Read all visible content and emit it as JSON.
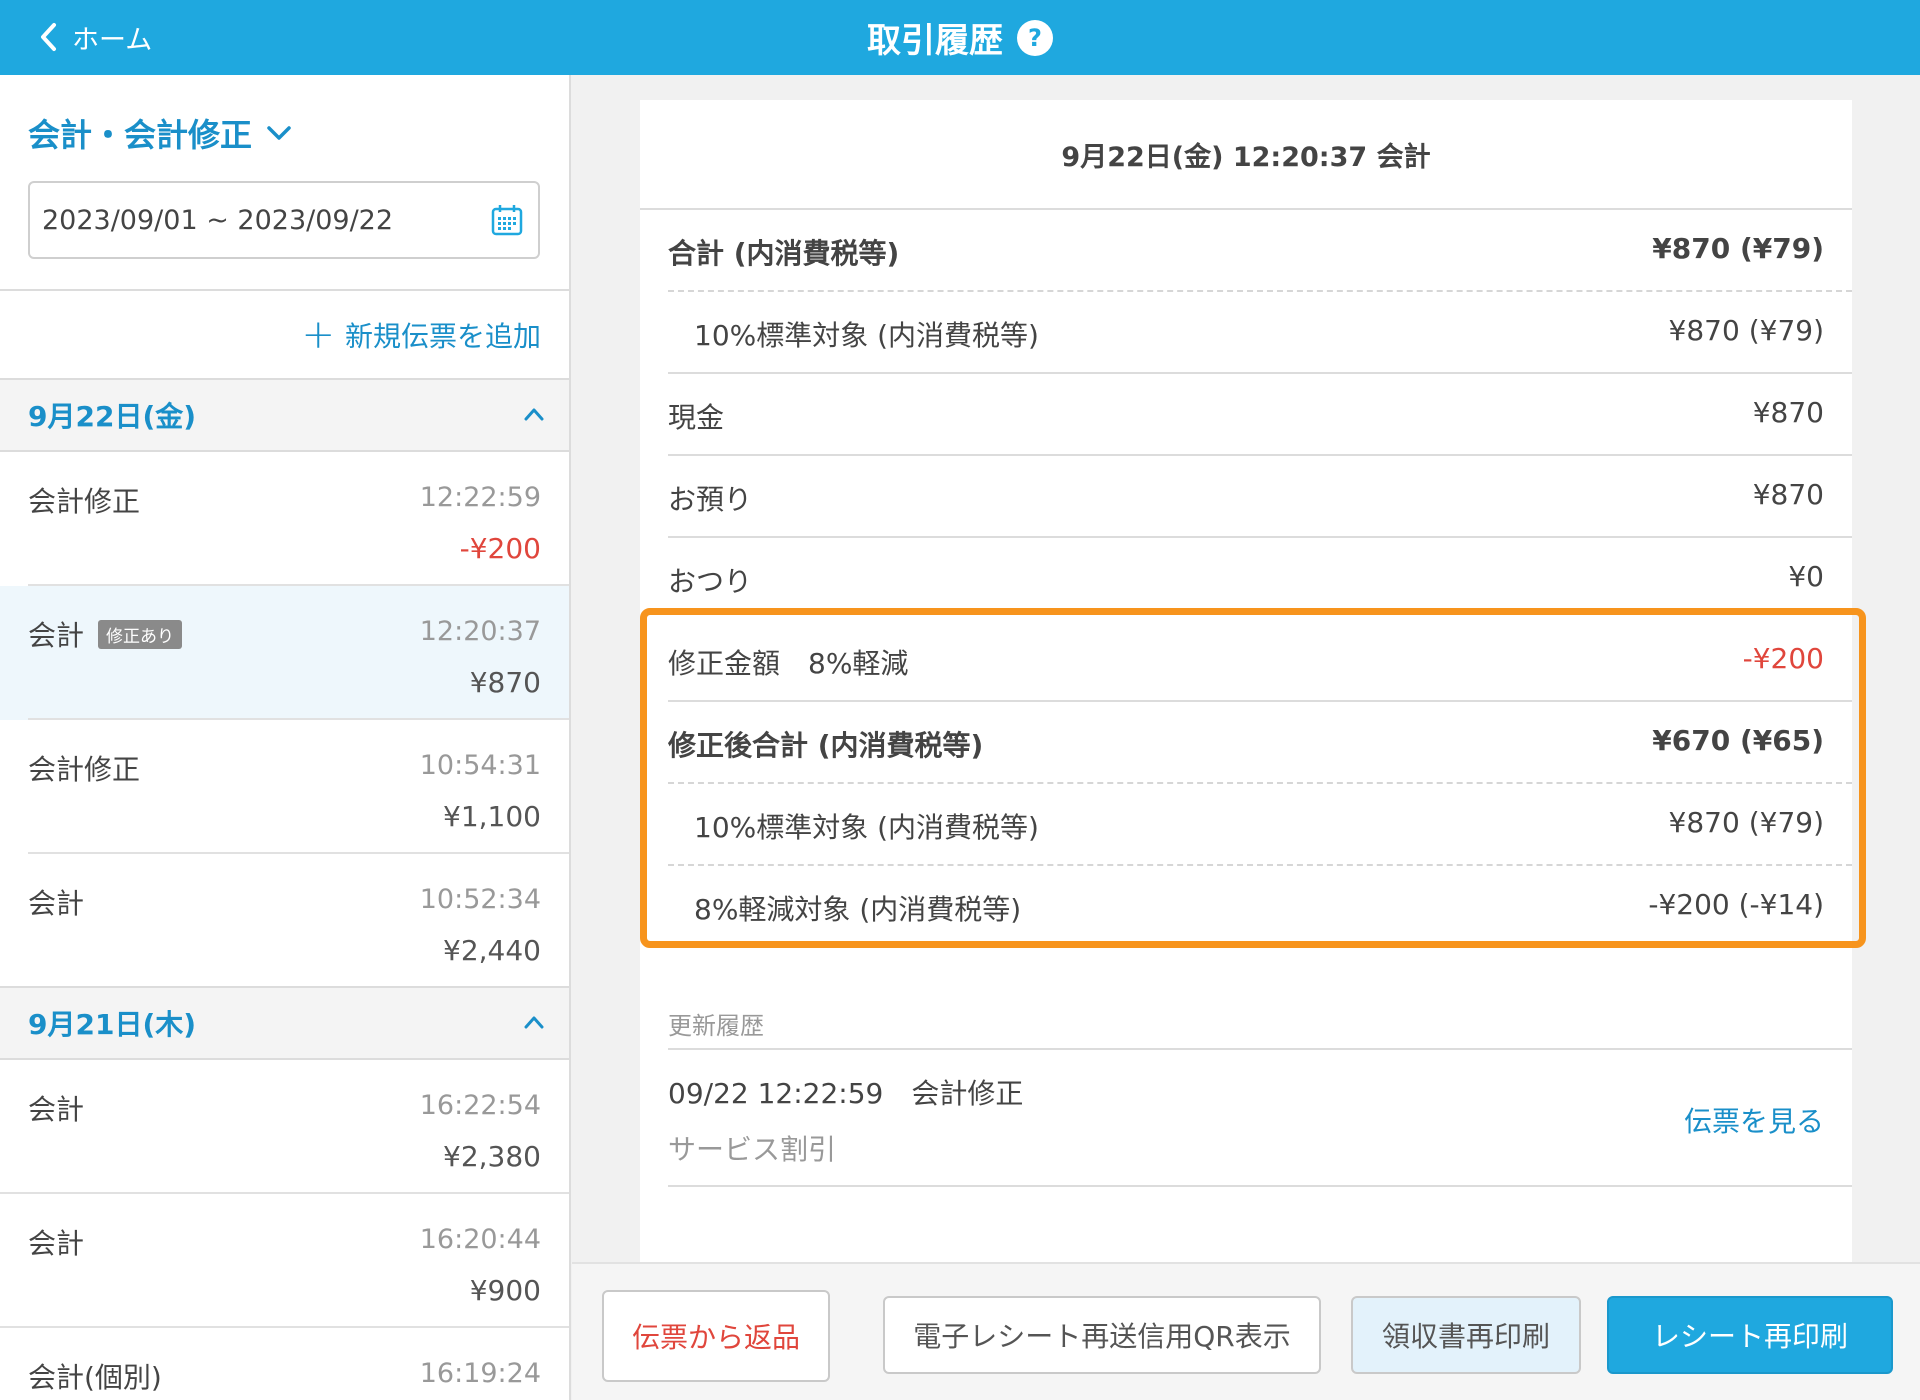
{
  "header": {
    "back_label": "ホーム",
    "title": "取引履歴",
    "help_symbol": "?"
  },
  "sidebar": {
    "filter_label": "会計・会計修正",
    "date_range": "2023/09/01 ~ 2023/09/22",
    "add_slip_label": "新規伝票を追加",
    "add_slip_symbol": "+",
    "groups": [
      {
        "date": "9月22日(金)",
        "items": [
          {
            "name": "会計修正",
            "time": "12:22:59",
            "amount": "-¥200",
            "badge": ""
          },
          {
            "name": "会計",
            "time": "12:20:37",
            "amount": "¥870",
            "badge": "修正あり"
          },
          {
            "name": "会計修正",
            "time": "10:54:31",
            "amount": "¥1,100",
            "badge": ""
          },
          {
            "name": "会計",
            "time": "10:52:34",
            "amount": "¥2,440",
            "badge": ""
          }
        ]
      },
      {
        "date": "9月21日(木)",
        "items": [
          {
            "name": "会計",
            "time": "16:22:54",
            "amount": "¥2,380",
            "badge": ""
          },
          {
            "name": "会計",
            "time": "16:20:44",
            "amount": "¥900",
            "badge": ""
          },
          {
            "name": "会計(個別)",
            "time": "16:19:24",
            "amount": "",
            "badge": ""
          }
        ]
      }
    ]
  },
  "detail": {
    "heading": "9月22日(金) 12:20:37 会計",
    "rows": [
      {
        "label": "合計 (内消費税等)",
        "value": "¥870 (¥79)"
      },
      {
        "label": "10%標準対象 (内消費税等)",
        "value": "¥870 (¥79)"
      },
      {
        "label": "現金",
        "value": "¥870"
      },
      {
        "label": "お預り",
        "value": "¥870"
      },
      {
        "label": "おつり",
        "value": "¥0"
      },
      {
        "label": "修正金額　8%軽減",
        "value": "-¥200"
      },
      {
        "label": "修正後合計 (内消費税等)",
        "value": "¥670 (¥65)"
      },
      {
        "label": "10%標準対象 (内消費税等)",
        "value": "¥870 (¥79)"
      },
      {
        "label": "8%軽減対象 (内消費税等)",
        "value": "-¥200 (-¥14)"
      }
    ],
    "history_title": "更新履歴",
    "history_entry": "09/22 12:22:59　会計修正",
    "history_note": "サービス割引",
    "view_slip_label": "伝票を見る"
  },
  "buttons": {
    "return_label": "伝票から返品",
    "qr_label": "電子レシート再送信用QR表示",
    "receipt_label": "領収書再印刷",
    "reprint_label": "レシート再印刷"
  },
  "colors": {
    "accent": "#1fa8df",
    "link": "#1a8fc9",
    "negative": "#e0463c",
    "highlight": "#f7941d"
  }
}
